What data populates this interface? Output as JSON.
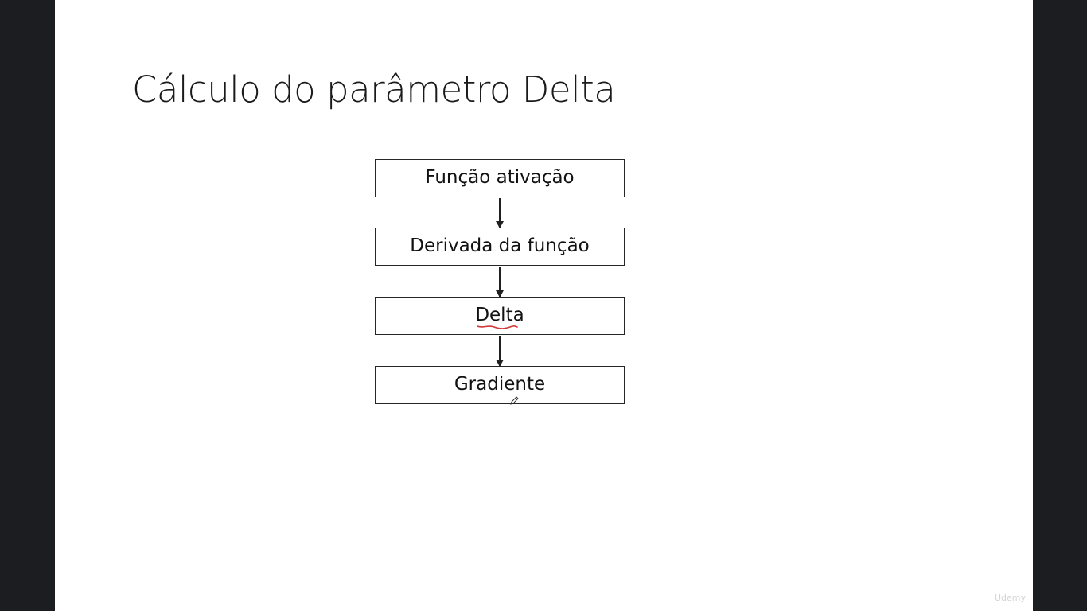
{
  "slide": {
    "title": "Cálculo do parâmetro Delta",
    "flow": [
      {
        "label": "Função ativação"
      },
      {
        "label": "Derivada da função"
      },
      {
        "label": "Delta"
      },
      {
        "label": "Gradiente"
      }
    ]
  },
  "annotations": {
    "underline_color": "#d23a3a",
    "cursor_icon": "pen-cursor-icon"
  },
  "watermark": {
    "text": "Udemy"
  },
  "colors": {
    "letterbox": "#1c1d21",
    "slide_bg": "#ffffff",
    "box_border": "#262626",
    "text": "#111111"
  }
}
